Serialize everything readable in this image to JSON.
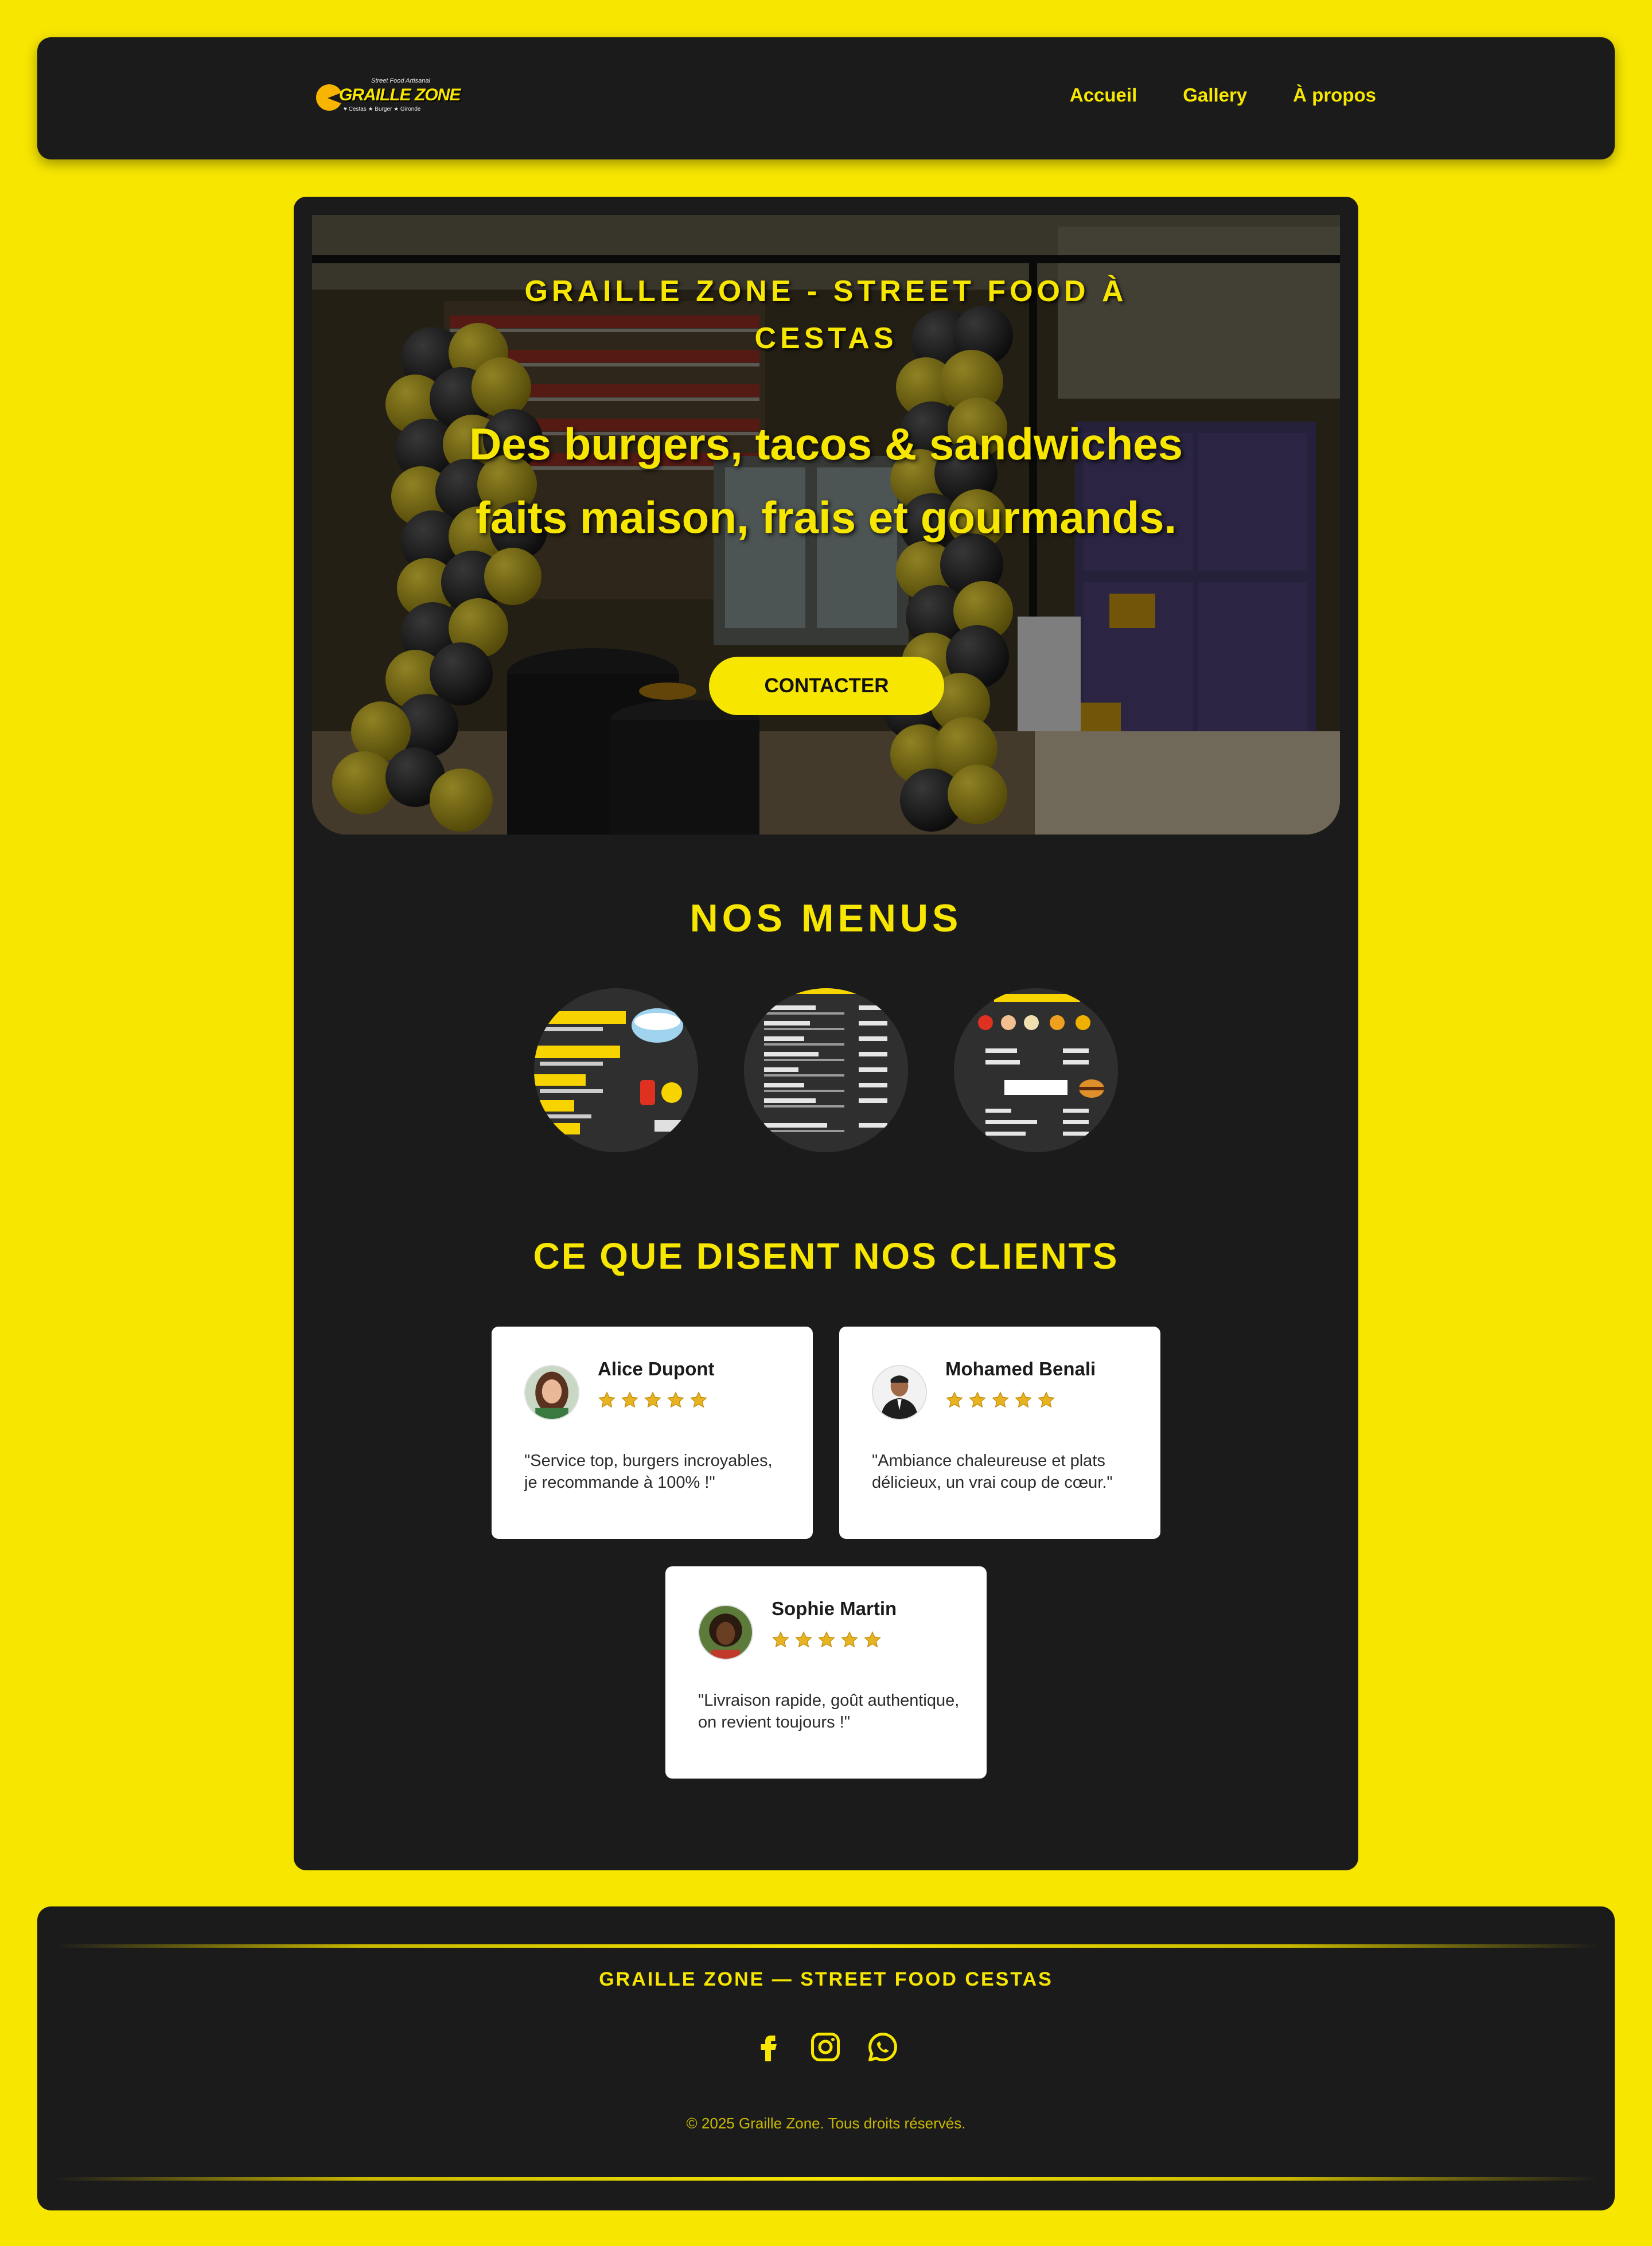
{
  "brand": {
    "name": "GRAILLE ZONE",
    "tagline": "Street Food Artisanal",
    "sub": "♥ Cestas ★ Burger ★ Gironde",
    "accent_color": "#f7e600",
    "dark_color": "#1b1b1b"
  },
  "nav": {
    "items": [
      {
        "label": "Accueil"
      },
      {
        "label": "Gallery"
      },
      {
        "label": "À propos"
      }
    ]
  },
  "hero": {
    "title": "GRAILLE ZONE - STREET FOOD À CESTAS",
    "subtitle": "Des burgers, tacos & sandwiches faits maison, frais et gourmands.",
    "cta_label": "CONTACTER"
  },
  "menus": {
    "title": "NOS MENUS",
    "items": [
      {
        "image": "menu-thai-curry-icon"
      },
      {
        "image": "menu-tacos-list-icon"
      },
      {
        "image": "menu-burger-cheese-icon"
      }
    ]
  },
  "testimonials": {
    "title": "CE QUE DISENT NOS CLIENTS",
    "items": [
      {
        "name": "Alice Dupont",
        "rating": 5,
        "text": "\"Service top, burgers incroyables, je recommande à 100% !\""
      },
      {
        "name": "Mohamed Benali",
        "rating": 5,
        "text": "\"Ambiance chaleureuse et plats délicieux, un vrai coup de cœur.\""
      },
      {
        "name": "Sophie Martin",
        "rating": 5,
        "text": "\"Livraison rapide, goût authentique, on revient toujours !\""
      }
    ]
  },
  "footer": {
    "title": "GRAILLE ZONE — STREET FOOD CESTAS",
    "socials": [
      "facebook-icon",
      "instagram-icon",
      "whatsapp-icon"
    ],
    "copyright": "© 2025 Graille Zone. Tous droits réservés."
  }
}
